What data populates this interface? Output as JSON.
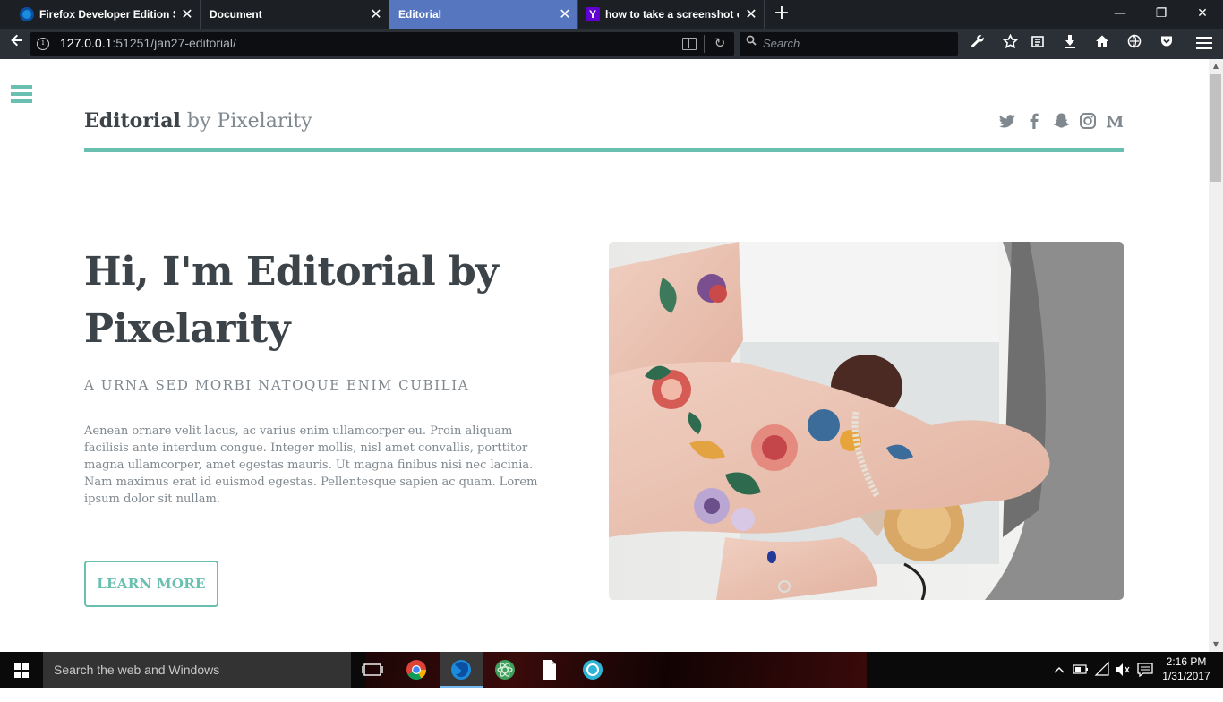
{
  "browser": {
    "tabs": [
      {
        "title": "Firefox Developer Edition Sta",
        "icon": "firefox-dev-icon",
        "active": false
      },
      {
        "title": "Document",
        "icon": "",
        "active": false
      },
      {
        "title": "Editorial",
        "icon": "",
        "active": true
      },
      {
        "title": "how to take a screenshot on",
        "icon": "yahoo-icon",
        "active": false
      }
    ],
    "new_tab_label": "+",
    "url_host": "127.0.0.1",
    "url_rest": ":51251/jan27-editorial/",
    "search_placeholder": "Search",
    "colors": {
      "active_tab": "#5677c0",
      "chrome_dark": "#2b2f36"
    }
  },
  "page": {
    "logo_strong": "Editorial",
    "logo_light": "by Pixelarity",
    "social_icons": [
      "twitter-icon",
      "facebook-icon",
      "snapchat-icon",
      "instagram-icon",
      "medium-icon"
    ],
    "hero_title": "Hi, I'm Editorial by Pixelarity",
    "hero_subtitle": "A URNA SED MORBI NATOQUE ENIM CUBILIA",
    "hero_text": "Aenean ornare velit lacus, ac varius enim ullamcorper eu. Proin aliquam facilisis ante interdum congue. Integer mollis, nisl amet convallis, porttitor magna ullamcorper, amet egestas mauris. Ut magna finibus nisi nec lacinia. Nam maximus erat id euismod egestas. Pellentesque sapien ac quam. Lorem ipsum dolor sit nullam.",
    "cta_label": "LEARN MORE",
    "accent_color": "#6ac0b0",
    "text_color": "#3d4449"
  },
  "taskbar": {
    "search_text": "Search the web and Windows",
    "time": "2:16 PM",
    "date": "1/31/2017"
  }
}
